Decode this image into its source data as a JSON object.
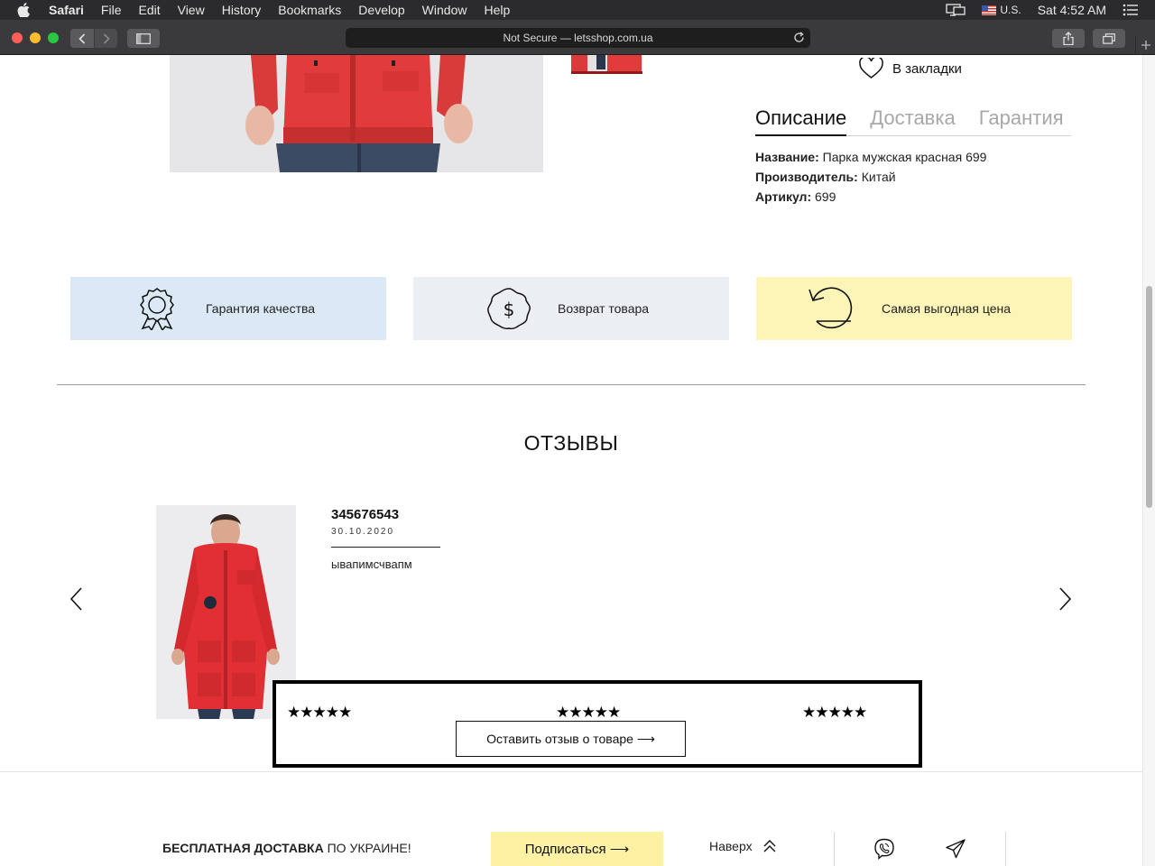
{
  "menubar": {
    "app": "Safari",
    "items": [
      "File",
      "Edit",
      "View",
      "History",
      "Bookmarks",
      "Develop",
      "Window",
      "Help"
    ],
    "input_source": "U.S.",
    "clock": "Sat 4:52 AM"
  },
  "browser": {
    "address": "Not Secure — letsshop.com.ua"
  },
  "product": {
    "bookmark_label": "В закладки",
    "tabs": [
      "Описание",
      "Доставка",
      "Гарантия"
    ],
    "specs": [
      {
        "key": "Название:",
        "value": " Парка мужская красная 699"
      },
      {
        "key": "Производитель:",
        "value": " Китай"
      },
      {
        "key": "Артикул:",
        "value": " 699"
      }
    ]
  },
  "features": [
    {
      "label": "Гарантия качества",
      "icon": "award-icon",
      "color": "#dbe9f6"
    },
    {
      "label": "Возврат товара",
      "icon": "dollar-badge-icon",
      "color": "#ebeef3"
    },
    {
      "label": "Самая выгодная цена",
      "icon": "undo-arrow-icon",
      "color": "#fdf4b7"
    }
  ],
  "reviews": {
    "title": "ОТЗЫВЫ",
    "author": "345676543",
    "date": "30.10.2020",
    "text": "ывапимсчвапм",
    "stars": [
      "★★★★★",
      "★★★★★",
      "★★★★★"
    ],
    "leave_review_label": "Оставить отзыв о товаре ⟶"
  },
  "footer": {
    "free_shipping_bold": "БЕСПЛАТНАЯ ДОСТАВКА",
    "free_shipping_rest": " ПО УКРАИНЕ!",
    "subscribe_label": "Подписаться ⟶",
    "to_top_label": "Наверх"
  }
}
